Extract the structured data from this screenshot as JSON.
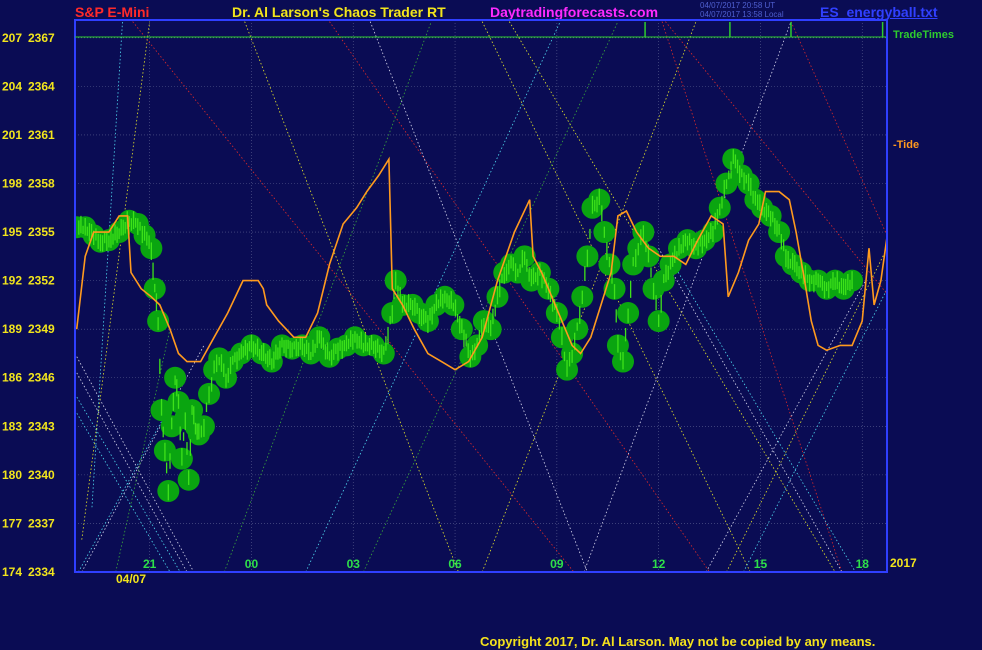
{
  "header": {
    "symbol": "S&P E-Mini",
    "program": "Dr. Al Larson's Chaos Trader RT",
    "website": "Daytradingforecasts.com",
    "datafile": "ES_energyball.txt",
    "time_ut": "04/07/2017 20:58 UT",
    "time_local": "04/07/2017 13:58 Local"
  },
  "footer": {
    "copyright": "Copyright 2017, Dr. Al Larson. May not be copied by any means."
  },
  "colors": {
    "background": "#0a0c54",
    "plot_border": "#2f3fff",
    "grid": "#5a5f90",
    "price_bars": "#3ee21a",
    "energy_ball": "#0aa510",
    "tide": "#ff9a1e",
    "trade_times": "#2ecc2e",
    "axis_text": "#f2e51c",
    "time_ticks": "#2ee04a",
    "symbol": "#ff2a2a",
    "website": "#ff2aff",
    "lines_white": "#d8d8ee",
    "lines_cyan": "#4fd8f0",
    "lines_red": "#e02a2a",
    "lines_yellow": "#e6e62a",
    "lines_green": "#3aaa3a"
  },
  "chart_data": {
    "type": "line",
    "title": "S&P E-Mini",
    "xlabel": "",
    "ylabel": "",
    "x_ticks": [
      "21",
      "00",
      "03",
      "06",
      "09",
      "12",
      "15",
      "18"
    ],
    "x_tick_hours": [
      21,
      24,
      27,
      30,
      33,
      36,
      39,
      42
    ],
    "x_range_hours": [
      18.8,
      42.7
    ],
    "date_label": "04/07",
    "year_label": "2017",
    "ylim": [
      2334,
      2368.1
    ],
    "y_ticks": [
      {
        "left": "174",
        "right": "2334"
      },
      {
        "left": "177",
        "right": "2337"
      },
      {
        "left": "180",
        "right": "2340"
      },
      {
        "left": "183",
        "right": "2343"
      },
      {
        "left": "186",
        "right": "2346"
      },
      {
        "left": "189",
        "right": "2349"
      },
      {
        "left": "192",
        "right": "2352"
      },
      {
        "left": "195",
        "right": "2355"
      },
      {
        "left": "198",
        "right": "2358"
      },
      {
        "left": "201",
        "right": "2361"
      },
      {
        "left": "204",
        "right": "2364"
      },
      {
        "left": "207",
        "right": "2367"
      }
    ],
    "grid": true,
    "series": [
      {
        "name": "Tide",
        "label": "-Tide",
        "style": "line",
        "points": [
          [
            18.85,
            2349
          ],
          [
            19.1,
            2353.5
          ],
          [
            19.35,
            2355
          ],
          [
            19.8,
            2355
          ],
          [
            20.1,
            2356
          ],
          [
            20.35,
            2356
          ],
          [
            20.45,
            2352.5
          ],
          [
            20.75,
            2351.5
          ],
          [
            21.05,
            2351
          ],
          [
            21.3,
            2350.5
          ],
          [
            21.6,
            2349
          ],
          [
            21.85,
            2347.5
          ],
          [
            22.1,
            2347
          ],
          [
            22.5,
            2347
          ],
          [
            22.9,
            2348.5
          ],
          [
            23.3,
            2350
          ],
          [
            23.75,
            2352
          ],
          [
            24.2,
            2352
          ],
          [
            24.35,
            2351.5
          ],
          [
            24.45,
            2350.5
          ],
          [
            24.8,
            2349.5
          ],
          [
            25.25,
            2348.5
          ],
          [
            25.6,
            2348.5
          ],
          [
            25.95,
            2350
          ],
          [
            26.3,
            2353
          ],
          [
            26.7,
            2355.5
          ],
          [
            27.1,
            2356.5
          ],
          [
            27.4,
            2357.5
          ],
          [
            27.75,
            2358.5
          ],
          [
            28.05,
            2359.5
          ],
          [
            28.15,
            2351.5
          ],
          [
            28.45,
            2350.5
          ],
          [
            28.8,
            2349
          ],
          [
            29.2,
            2347.5
          ],
          [
            29.6,
            2347
          ],
          [
            30,
            2346.5
          ],
          [
            30.4,
            2347
          ],
          [
            30.8,
            2348.5
          ],
          [
            31.25,
            2352
          ],
          [
            31.75,
            2355
          ],
          [
            32.2,
            2357
          ],
          [
            32.3,
            2353.5
          ],
          [
            32.55,
            2352.5
          ],
          [
            32.85,
            2351
          ],
          [
            33.15,
            2349.5
          ],
          [
            33.45,
            2348
          ],
          [
            33.7,
            2347.5
          ],
          [
            34,
            2348.5
          ],
          [
            34.3,
            2350.5
          ],
          [
            34.6,
            2352.5
          ],
          [
            34.8,
            2356
          ],
          [
            35.05,
            2356.3
          ],
          [
            35.35,
            2355
          ],
          [
            35.7,
            2354
          ],
          [
            36.05,
            2353.5
          ],
          [
            36.45,
            2353.5
          ],
          [
            36.8,
            2353
          ],
          [
            37.15,
            2354.5
          ],
          [
            37.55,
            2356
          ],
          [
            37.9,
            2355.5
          ],
          [
            38.05,
            2351
          ],
          [
            38.35,
            2352.5
          ],
          [
            38.65,
            2354.5
          ],
          [
            38.95,
            2355.5
          ],
          [
            39.15,
            2357.5
          ],
          [
            39.55,
            2357.5
          ],
          [
            39.85,
            2357
          ],
          [
            40.05,
            2355
          ],
          [
            40.3,
            2352
          ],
          [
            40.5,
            2349.5
          ],
          [
            40.7,
            2348
          ],
          [
            40.95,
            2347.7
          ],
          [
            41.35,
            2348
          ],
          [
            41.7,
            2348
          ],
          [
            42,
            2349.5
          ],
          [
            42.2,
            2354
          ],
          [
            42.35,
            2350.5
          ],
          [
            42.55,
            2352
          ],
          [
            42.75,
            2355
          ],
          [
            42.95,
            2357
          ],
          [
            43.25,
            2359.5
          ],
          [
            43.6,
            2360.5
          ]
        ]
      },
      {
        "name": "S&P E-Mini",
        "style": "bars",
        "points": [
          [
            18.85,
            2355.3
          ],
          [
            19.1,
            2355.3
          ],
          [
            19.35,
            2354.8
          ],
          [
            19.55,
            2354.4
          ],
          [
            19.8,
            2354.5
          ],
          [
            20.1,
            2355
          ],
          [
            20.4,
            2355.7
          ],
          [
            20.65,
            2355.5
          ],
          [
            20.85,
            2354.8
          ],
          [
            21.05,
            2354
          ],
          [
            21.15,
            2351.5
          ],
          [
            21.25,
            2349.5
          ],
          [
            21.35,
            2344
          ],
          [
            21.45,
            2341.5
          ],
          [
            21.55,
            2339
          ],
          [
            21.65,
            2343
          ],
          [
            21.75,
            2346
          ],
          [
            21.85,
            2344.5
          ],
          [
            21.95,
            2341
          ],
          [
            22.05,
            2343.5
          ],
          [
            22.15,
            2339.7
          ],
          [
            22.25,
            2344
          ],
          [
            22.35,
            2343
          ],
          [
            22.45,
            2342.5
          ],
          [
            22.6,
            2343
          ],
          [
            22.75,
            2345
          ],
          [
            22.9,
            2346.5
          ],
          [
            23.05,
            2347.2
          ],
          [
            23.25,
            2346
          ],
          [
            23.45,
            2347
          ],
          [
            23.7,
            2347.5
          ],
          [
            24,
            2348
          ],
          [
            24.3,
            2347.5
          ],
          [
            24.6,
            2347
          ],
          [
            24.9,
            2348
          ],
          [
            25.2,
            2347.8
          ],
          [
            25.5,
            2348
          ],
          [
            25.75,
            2347.5
          ],
          [
            26,
            2348.5
          ],
          [
            26.3,
            2347.3
          ],
          [
            26.55,
            2347.8
          ],
          [
            26.8,
            2348
          ],
          [
            27.05,
            2348.5
          ],
          [
            27.3,
            2348
          ],
          [
            27.6,
            2348
          ],
          [
            27.9,
            2347.5
          ],
          [
            28.15,
            2350
          ],
          [
            28.25,
            2352
          ],
          [
            28.45,
            2350.5
          ],
          [
            28.75,
            2350.5
          ],
          [
            28.95,
            2350
          ],
          [
            29.2,
            2349.5
          ],
          [
            29.45,
            2350.5
          ],
          [
            29.7,
            2351
          ],
          [
            29.95,
            2350.5
          ],
          [
            30.2,
            2349
          ],
          [
            30.45,
            2347.3
          ],
          [
            30.65,
            2348
          ],
          [
            30.85,
            2349.5
          ],
          [
            31.05,
            2349
          ],
          [
            31.25,
            2351
          ],
          [
            31.45,
            2352.5
          ],
          [
            31.65,
            2353
          ],
          [
            31.85,
            2352.5
          ],
          [
            32.05,
            2353.5
          ],
          [
            32.25,
            2352
          ],
          [
            32.5,
            2352.5
          ],
          [
            32.75,
            2351.5
          ],
          [
            33,
            2350
          ],
          [
            33.15,
            2348.5
          ],
          [
            33.3,
            2346.5
          ],
          [
            33.45,
            2347.5
          ],
          [
            33.6,
            2349
          ],
          [
            33.75,
            2351
          ],
          [
            33.9,
            2353.5
          ],
          [
            34.05,
            2356.5
          ],
          [
            34.25,
            2357
          ],
          [
            34.4,
            2355
          ],
          [
            34.55,
            2353
          ],
          [
            34.7,
            2351.5
          ],
          [
            34.8,
            2348
          ],
          [
            34.95,
            2347
          ],
          [
            35.1,
            2350
          ],
          [
            35.25,
            2353
          ],
          [
            35.4,
            2354
          ],
          [
            35.55,
            2355
          ],
          [
            35.7,
            2353.5
          ],
          [
            35.85,
            2351.5
          ],
          [
            36,
            2349.5
          ],
          [
            36.15,
            2352
          ],
          [
            36.35,
            2353
          ],
          [
            36.6,
            2354
          ],
          [
            36.85,
            2354.5
          ],
          [
            37.1,
            2354
          ],
          [
            37.35,
            2354.5
          ],
          [
            37.6,
            2355
          ],
          [
            37.8,
            2356.5
          ],
          [
            38,
            2358
          ],
          [
            38.2,
            2359.5
          ],
          [
            38.45,
            2358.5
          ],
          [
            38.65,
            2358
          ],
          [
            38.85,
            2357
          ],
          [
            39.05,
            2356.5
          ],
          [
            39.3,
            2356
          ],
          [
            39.55,
            2355
          ],
          [
            39.75,
            2353.5
          ],
          [
            39.95,
            2353
          ],
          [
            40.2,
            2352.5
          ],
          [
            40.45,
            2352
          ],
          [
            40.7,
            2352
          ],
          [
            40.95,
            2351.5
          ],
          [
            41.2,
            2352
          ],
          [
            41.45,
            2351.5
          ],
          [
            41.7,
            2352
          ]
        ]
      },
      {
        "name": "TradeTimes",
        "label": "TradeTimes",
        "style": "spikes",
        "x": [
          35.6,
          38.1,
          39.9,
          42.6
        ]
      }
    ]
  }
}
